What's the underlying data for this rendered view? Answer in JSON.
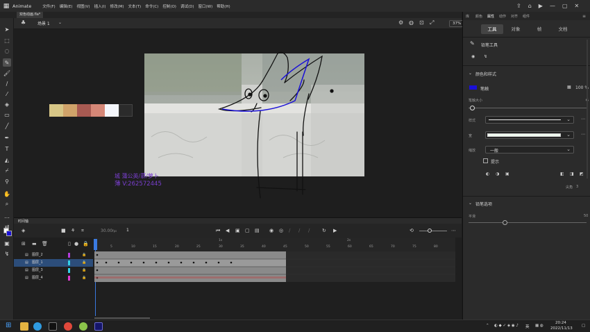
{
  "menubar": {
    "app_name": "Animate",
    "menus": [
      "文件(F)",
      "编辑(E)",
      "视图(V)",
      "插入(I)",
      "修改(M)",
      "文本(T)",
      "命令(C)",
      "控制(O)",
      "调试(D)",
      "窗口(W)",
      "帮助(H)"
    ]
  },
  "document": {
    "tab_title": "双色动画.fla*"
  },
  "scene": {
    "label": "场景 1",
    "zoom": "37%"
  },
  "stage": {
    "swatches": [
      "#d7c686",
      "#d0a36a",
      "#a85a52",
      "#d58777",
      "#f4f6fb",
      "#2b2b2b"
    ],
    "watermark_line1": "城    蒲公英/慕/萝卜",
    "watermark_line2": "薄    V:262572445"
  },
  "timeline": {
    "title": "时间轴",
    "fps": "30.00",
    "fps_unit": "fps",
    "current_frame": "1",
    "ruler": [
      "1s",
      "2s",
      "5",
      "10",
      "15",
      "20",
      "25",
      "30",
      "35",
      "40",
      "45",
      "50",
      "55",
      "60",
      "65",
      "70",
      "75",
      "80"
    ],
    "layers": [
      {
        "name": "图层_2",
        "color": "#b43cdc",
        "selected": false
      },
      {
        "name": "图层_1",
        "color": "#33d0e8",
        "selected": true
      },
      {
        "name": "图层_3",
        "color": "#33d0e8",
        "selected": false
      },
      {
        "name": "图层_4",
        "color": "#e03bd0",
        "selected": false
      }
    ]
  },
  "right_panel": {
    "top_tabs": [
      "库",
      "颜色",
      "属性",
      "动作",
      "对齐",
      "组件"
    ],
    "segments": [
      "工具",
      "对象",
      "帧",
      "文档"
    ],
    "tool_name": "铅笔工具",
    "section_color": "颜色和样式",
    "stroke_label": "笔触",
    "stroke_color": "#1a10d8",
    "stroke_opacity": "100 %",
    "stroke_size_label": "笔触大小",
    "stroke_size_value": "6",
    "style_label": "样式",
    "width_label": "宽",
    "scale_label": "缩放",
    "scale_value": "一般",
    "hint_label": "提示",
    "section_pencil": "铅笔选项",
    "smooth_label": "平滑",
    "smooth_value": "50",
    "miter_label": "尖角",
    "miter_value": "3"
  },
  "taskbar": {
    "time": "20:24",
    "date": "2022/11/13",
    "lang": "英"
  }
}
